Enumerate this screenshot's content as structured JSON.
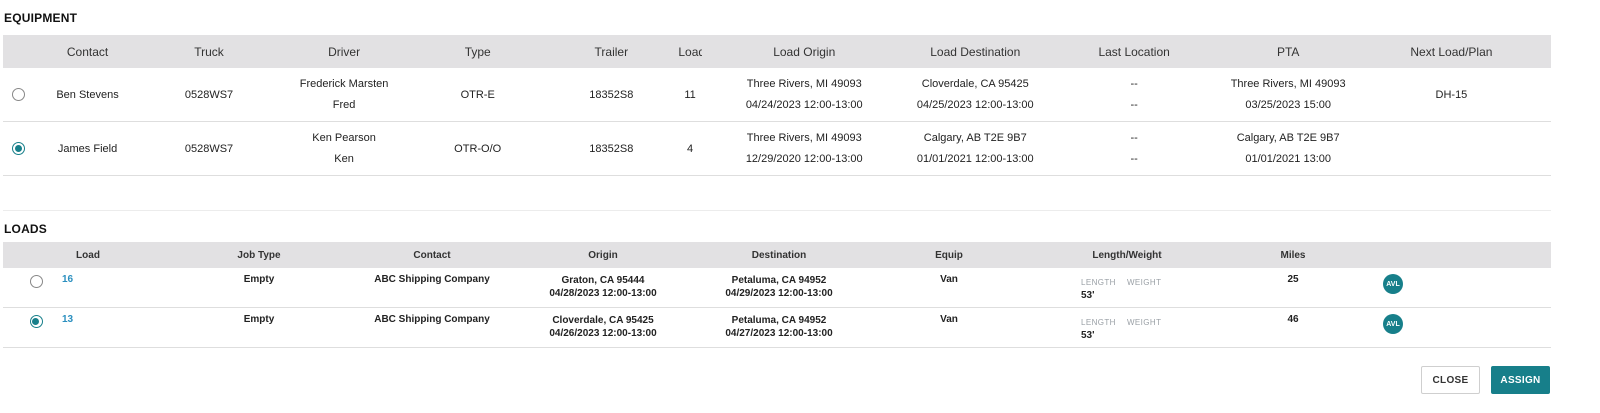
{
  "equipment": {
    "title": "EQUIPMENT",
    "headers": [
      "Contact",
      "Truck",
      "Driver",
      "Type",
      "Trailer",
      "Load",
      "Load Origin",
      "Load Destination",
      "Last Location",
      "PTA",
      "Next Load/Plan"
    ],
    "rows": [
      {
        "selected": false,
        "contact": "Ben Stevens",
        "truck": "0528WS7",
        "driver_name": "Frederick Marsten",
        "driver_nick": "Fred",
        "type": "OTR-E",
        "trailer": "18352S8",
        "load": "11",
        "origin_place": "Three Rivers, MI 49093",
        "origin_time": "04/24/2023 12:00-13:00",
        "dest_place": "Cloverdale, CA 95425",
        "dest_time": "04/25/2023 12:00-13:00",
        "last_loc_1": "--",
        "last_loc_2": "--",
        "pta_place": "Three Rivers, MI 49093",
        "pta_time": "03/25/2023 15:00",
        "next": "DH-15"
      },
      {
        "selected": true,
        "contact": "James Field",
        "truck": "0528WS7",
        "driver_name": "Ken Pearson",
        "driver_nick": "Ken",
        "type": "OTR-O/O",
        "trailer": "18352S8",
        "load": "4",
        "origin_place": "Three Rivers, MI 49093",
        "origin_time": "12/29/2020 12:00-13:00",
        "dest_place": "Calgary, AB T2E 9B7",
        "dest_time": "01/01/2021 12:00-13:00",
        "last_loc_1": "--",
        "last_loc_2": "--",
        "pta_place": "Calgary, AB T2E 9B7",
        "pta_time": "01/01/2021 13:00",
        "next": ""
      }
    ]
  },
  "loads": {
    "title": "LOADS",
    "headers": [
      "Load",
      "Job Type",
      "Contact",
      "Origin",
      "Destination",
      "Equip",
      "Length/Weight",
      "Miles"
    ],
    "rows": [
      {
        "selected": false,
        "load": "16",
        "job_type": "Empty",
        "contact": "ABC Shipping Company",
        "origin_place": "Graton, CA 95444",
        "origin_time": "04/28/2023 12:00-13:00",
        "dest_place": "Petaluma, CA 94952",
        "dest_time": "04/29/2023 12:00-13:00",
        "equip": "Van",
        "length_label": "LENGTH",
        "weight_label": "WEIGHT",
        "length": "53'",
        "miles": "25",
        "badge": "AVL"
      },
      {
        "selected": true,
        "load": "13",
        "job_type": "Empty",
        "contact": "ABC Shipping Company",
        "origin_place": "Cloverdale, CA 95425",
        "origin_time": "04/26/2023 12:00-13:00",
        "dest_place": "Petaluma, CA 94952",
        "dest_time": "04/27/2023 12:00-13:00",
        "equip": "Van",
        "length_label": "LENGTH",
        "weight_label": "WEIGHT",
        "length": "53'",
        "miles": "46",
        "badge": "AVL"
      }
    ]
  },
  "actions": {
    "close_label": "CLOSE",
    "assign_label": "ASSIGN"
  },
  "colors": {
    "accent": "#177f8a",
    "link": "#2a8fbf",
    "header_bg": "#e2e1e3"
  }
}
